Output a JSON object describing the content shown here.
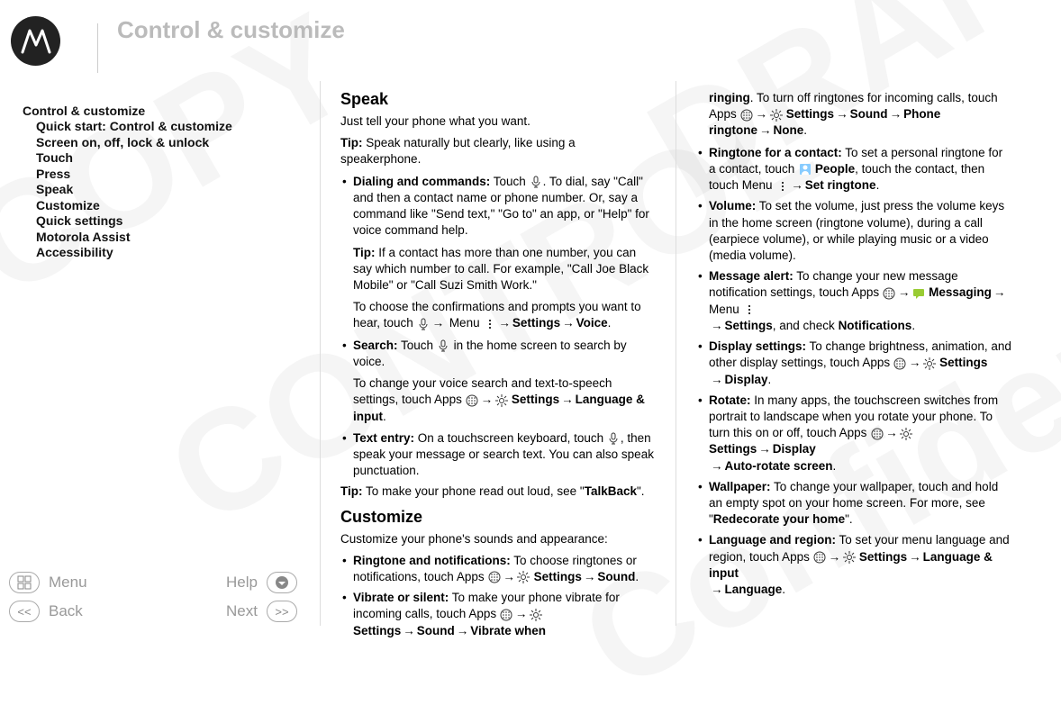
{
  "header": {
    "title": "Control & customize"
  },
  "sidebar": {
    "root": "Control & customize",
    "items": [
      "Quick start: Control & customize",
      "Screen on, off, lock & unlock",
      "Touch",
      "Press",
      "Speak",
      "Customize",
      "Quick settings",
      "Motorola Assist",
      "Accessibility"
    ]
  },
  "nav": {
    "menu": "Menu",
    "help": "Help",
    "back": "Back",
    "next": "Next"
  },
  "content": {
    "col1": {
      "speak_heading": "Speak",
      "speak_intro": "Just tell your phone what you want.",
      "speak_tip_label": "Tip:",
      "speak_tip": " Speak naturally but clearly, like using a speakerphone.",
      "dialing_label": "Dialing and commands:",
      "dialing_text": " Touch ",
      "dialing_text2": ". To dial, say \"Call\" and then a contact name or phone number. Or, say a command like \"Send text,\" \"Go to\" an app, or \"Help\" for voice command help.",
      "dialing_tip_label": "Tip:",
      "dialing_tip": " If a contact has more than one number, you can say which number to call. For example, \"Call Joe Black Mobile\" or \"Call Suzi Smith Work.\"",
      "confirm_text1": "To choose the confirmations and prompts you want to hear, touch ",
      "confirm_menu": " Menu ",
      "confirm_settings": "Settings",
      "confirm_voice": "Voice",
      "search_label": "Search:",
      "search_text": " Touch ",
      "search_text2": " in the home screen to search by voice.",
      "search_change": "To change your voice search and text-to-speech settings, touch Apps ",
      "search_settings": "Settings",
      "search_langinput": "Language & input",
      "textentry_label": "Text entry:",
      "textentry_text": " On a touchscreen keyboard, touch ",
      "textentry_text2": ", then speak your message or search text. You can also speak punctuation.",
      "readout_tip_label": "Tip:",
      "readout_tip": " To make your phone read out loud, see \"",
      "readout_talkback": "TalkBack",
      "readout_end": "\".",
      "customize_heading": "Customize",
      "customize_intro": "Customize your phone's sounds and appearance:",
      "ringtone_label": "Ringtone and notifications:",
      "ringtone_text": " To choose ringtones or notifications, touch Apps ",
      "ringtone_settings": "Settings",
      "ringtone_sound": "Sound",
      "vibrate_label": "Vibrate or silent:",
      "vibrate_text": " To make your phone vibrate for incoming calls, touch Apps ",
      "vibrate_settings": "Settings",
      "vibrate_sound": "Sound",
      "vibrate_when": "Vibrate when"
    },
    "col2": {
      "ringing": "ringing",
      "ringing_text": ". To turn off ringtones for incoming calls, touch Apps ",
      "ringing_settings": "Settings",
      "ringing_sound": "Sound",
      "ringing_phone_ringtone": "Phone ringtone",
      "ringing_none": "None",
      "ringtone_contact_label": "Ringtone for a contact:",
      "ringtone_contact_text": " To set a personal ringtone for a contact, touch ",
      "people": "People",
      "ringtone_contact_text2": ", touch the contact, then touch Menu ",
      "set_ringtone": "Set ringtone",
      "volume_label": "Volume:",
      "volume_text": " To set the volume, just press the volume keys in the home screen (ringtone volume), during a call (earpiece volume), or while playing music or a video (media volume).",
      "message_alert_label": "Message alert:",
      "message_alert_text": " To change your new message notification settings, touch Apps ",
      "messaging": "Messaging",
      "message_menu": " Menu ",
      "message_settings": "Settings",
      "message_notif": "Notifications",
      "message_check": ", and check ",
      "display_label": "Display settings:",
      "display_text": " To change brightness, animation, and other display settings, touch Apps ",
      "display_settings": "Settings",
      "display_display": "Display",
      "rotate_label": "Rotate:",
      "rotate_text": " In many apps, the touchscreen switches from portrait to landscape when you rotate your phone. To turn this on or off, touch Apps ",
      "rotate_settings": "Settings",
      "rotate_display": "Display",
      "rotate_auto": "Auto-rotate screen",
      "wallpaper_label": "Wallpaper:",
      "wallpaper_text": " To change your wallpaper, touch and hold an empty spot on your home screen. For more, see \"",
      "wallpaper_redecorate": "Redecorate your home",
      "wallpaper_end": "\".",
      "lang_label": "Language and region:",
      "lang_text": " To set your menu language and region, touch Apps ",
      "lang_settings": "Settings",
      "lang_langinput": "Language & input",
      "lang_language": "Language"
    }
  }
}
